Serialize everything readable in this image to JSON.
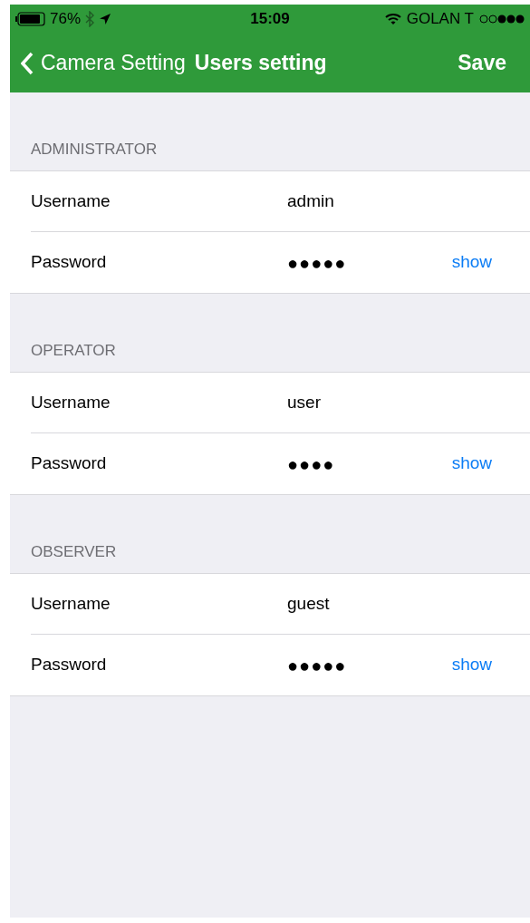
{
  "status_bar": {
    "battery": "76%",
    "time": "15:09",
    "carrier": "GOLAN T"
  },
  "nav_bar": {
    "back": "Camera Setting",
    "title": "Users setting",
    "action": "Save"
  },
  "sections": [
    {
      "header": "ADMINISTRATOR",
      "rows": [
        {
          "kind": "text",
          "label": "Username",
          "value": "admin"
        },
        {
          "kind": "password",
          "label": "Password",
          "value": "●●●●●",
          "action": "show"
        }
      ]
    },
    {
      "header": "OPERATOR",
      "rows": [
        {
          "kind": "text",
          "label": "Username",
          "value": "user"
        },
        {
          "kind": "password",
          "label": "Password",
          "value": "●●●●",
          "action": "show"
        }
      ]
    },
    {
      "header": "OBSERVER",
      "rows": [
        {
          "kind": "text",
          "label": "Username",
          "value": "guest"
        },
        {
          "kind": "password",
          "label": "Password",
          "value": "●●●●●",
          "action": "show"
        }
      ]
    }
  ]
}
